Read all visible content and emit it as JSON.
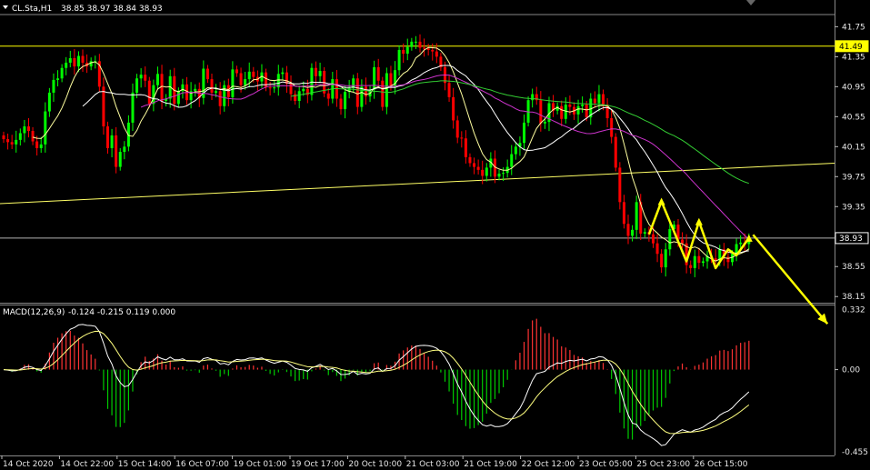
{
  "chart_data": {
    "type": "candlestick",
    "header": {
      "symbol": "CL.Sta,H1",
      "ohlc": "38.85 38.97 38.84 38.93"
    },
    "price_axis": {
      "ticks": [
        "41.75",
        "41.35",
        "40.95",
        "40.55",
        "40.15",
        "39.75",
        "39.35",
        "38.95",
        "38.55",
        "38.15"
      ],
      "tick_values": [
        41.75,
        41.35,
        40.95,
        40.55,
        40.15,
        39.75,
        39.35,
        38.95,
        38.55,
        38.15
      ],
      "ylim": [
        38.08,
        41.9
      ]
    },
    "time_axis": {
      "labels": [
        "14 Oct 2020",
        "14 Oct 22:00",
        "15 Oct 14:00",
        "16 Oct 07:00",
        "19 Oct 01:00",
        "19 Oct 17:00",
        "20 Oct 10:00",
        "21 Oct 03:00",
        "21 Oct 19:00",
        "22 Oct 12:00",
        "23 Oct 05:00",
        "25 Oct 23:00",
        "26 Oct 15:00"
      ]
    },
    "price_levels": [
      {
        "value": 41.49,
        "label": "41.49",
        "color": "#ffff00",
        "box": true
      },
      {
        "value": 38.93,
        "label": "38.93",
        "color": "#ffffff",
        "box": true
      }
    ],
    "trendline": {
      "from": [
        0,
        39.39
      ],
      "to": [
        1,
        39.93
      ],
      "color": "#ffff66"
    },
    "candles": {
      "count": 180,
      "up_color": "#00ff00",
      "down_color": "#ff0000",
      "closes": [
        40.25,
        40.21,
        40.18,
        40.24,
        40.33,
        40.42,
        40.36,
        40.22,
        40.13,
        40.18,
        40.62,
        40.87,
        41.04,
        41.06,
        41.2,
        41.27,
        41.33,
        41.22,
        41.36,
        41.27,
        41.22,
        41.29,
        41.29,
        40.95,
        40.42,
        40.13,
        40.3,
        39.88,
        40.08,
        40.15,
        40.47,
        40.87,
        41.06,
        41.11,
        41.03,
        40.72,
        40.97,
        41.12,
        40.76,
        40.79,
        41.09,
        40.72,
        40.89,
        40.98,
        40.77,
        40.89,
        40.92,
        40.8,
        41.19,
        41.05,
        40.87,
        40.89,
        40.69,
        40.97,
        40.81,
        41.18,
        41.13,
        40.97,
        41.05,
        41.15,
        41.08,
        41.02,
        41.14,
        40.94,
        40.93,
        40.94,
        41.12,
        41.14,
        40.99,
        40.85,
        40.76,
        40.89,
        40.92,
        40.84,
        41.2,
        41.09,
        41.16,
        40.86,
        40.79,
        41.05,
        40.79,
        40.65,
        40.88,
        40.93,
        41.06,
        40.68,
        40.95,
        40.82,
        40.91,
        41.21,
        41.03,
        40.68,
        41.13,
        40.96,
        41.17,
        41.44,
        41.39,
        41.48,
        41.55,
        41.55,
        41.47,
        41.46,
        41.44,
        41.42,
        41.35,
        41.21,
        41.0,
        40.81,
        40.5,
        40.27,
        40.26,
        40.01,
        39.93,
        39.88,
        39.84,
        39.76,
        39.87,
        39.99,
        39.75,
        39.79,
        39.8,
        39.88,
        40.05,
        40.15,
        40.2,
        40.47,
        40.77,
        40.85,
        40.77,
        40.46,
        40.48,
        40.73,
        40.63,
        40.69,
        40.52,
        40.71,
        40.68,
        40.58,
        40.69,
        40.71,
        40.54,
        40.79,
        40.73,
        40.85,
        40.71,
        40.53,
        40.28,
        39.87,
        39.41,
        39.12,
        38.96,
        39.04,
        39.41,
        38.99,
        39.01,
        38.98,
        38.86,
        38.72,
        38.54,
        38.78,
        39.05,
        39.11,
        38.91,
        38.86,
        38.57,
        38.53,
        38.69,
        38.6,
        38.62,
        38.69,
        38.66,
        38.63,
        38.78,
        38.68,
        38.61,
        38.72,
        38.85,
        38.87,
        38.85,
        38.93
      ]
    },
    "moving_averages": [
      {
        "period": 8,
        "color": "#ffffa0"
      },
      {
        "period": 20,
        "color": "#ffffff"
      },
      {
        "period": 34,
        "color": "#cc33cc"
      },
      {
        "period": 70,
        "color": "#33cc33"
      }
    ],
    "annotations": {
      "zigzag": [
        [
          155,
          38.98
        ],
        [
          158,
          39.42
        ],
        [
          164,
          38.62
        ],
        [
          167,
          39.15
        ],
        [
          171,
          38.53
        ],
        [
          174,
          38.78
        ],
        [
          176,
          38.7
        ],
        [
          179,
          38.93
        ]
      ],
      "forecast_arrow": {
        "from": [
          180,
          38.95
        ],
        "to": [
          190,
          38.15
        ]
      },
      "color": "#ffff00"
    },
    "macd": {
      "label": "MACD(12,26,9)",
      "values": "-0.124 -0.215 0.119 0.000",
      "ticks": [
        "0.332",
        "0.00",
        "-0.455"
      ],
      "tick_values": [
        0.332,
        0.0,
        -0.455
      ],
      "ylim": [
        -0.47,
        0.35
      ],
      "hist_up_color": "#ff3333",
      "hist_down_color": "#00cc00",
      "fast_color": "#ffffff",
      "signal_color": "#ffff80"
    }
  }
}
